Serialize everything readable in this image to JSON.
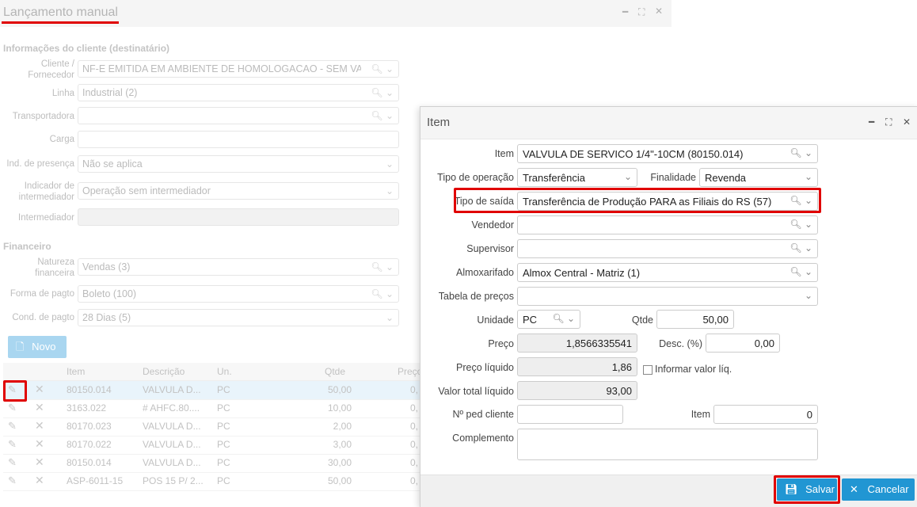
{
  "bg": {
    "title": "Lançamento manual",
    "section_client": "Informações do cliente (destinatário)",
    "section_fin": "Financeiro",
    "fields": {
      "cliente_label": "Cliente / Fornecedor",
      "cliente_value": "NF-E EMITIDA EM AMBIENTE DE HOMOLOGACAO - SEM VALOR",
      "linha_label": "Linha",
      "linha_value": "Industrial (2)",
      "transp_label": "Transportadora",
      "carga_label": "Carga",
      "presenca_label": "Ind. de presença",
      "presenca_value": "Não se aplica",
      "indicador_label": "Indicador de intermediador",
      "indicador_value": "Operação sem intermediador",
      "intermediador_label": "Intermediador",
      "natureza_label": "Natureza financeira",
      "natureza_value": "Vendas (3)",
      "forma_label": "Forma de pagto",
      "forma_value": "Boleto (100)",
      "cond_label": "Cond. de pagto",
      "cond_value": "28 Dias (5)"
    },
    "novo_label": "Novo",
    "grid": {
      "headers": [
        "Item",
        "Descrição",
        "Un.",
        "Qtde",
        "Preço"
      ],
      "rows": [
        {
          "item": "80150.014",
          "desc": "VALVULA D...",
          "un": "PC",
          "qtde": "50,00",
          "preco": "0,"
        },
        {
          "item": "3163.022",
          "desc": "# AHFC.80....",
          "un": "PC",
          "qtde": "10,00",
          "preco": "0,"
        },
        {
          "item": "80170.023",
          "desc": "VALVULA D...",
          "un": "PC",
          "qtde": "2,00",
          "preco": "0,"
        },
        {
          "item": "80170.022",
          "desc": "VALVULA D...",
          "un": "PC",
          "qtde": "3,00",
          "preco": "0,"
        },
        {
          "item": "80150.014",
          "desc": "VALVULA D...",
          "un": "PC",
          "qtde": "30,00",
          "preco": "0,"
        },
        {
          "item": "ASP-6011-15",
          "desc": "POS 15 P/ 2...",
          "un": "PC",
          "qtde": "50,00",
          "preco": "0,"
        }
      ]
    }
  },
  "dialog": {
    "title": "Item",
    "item_label": "Item",
    "item_value": "VALVULA DE SERVICO 1/4\"-10CM (80150.014)",
    "tipo_op_label": "Tipo de operação",
    "tipo_op_value": "Transferência",
    "finalidade_label": "Finalidade",
    "finalidade_value": "Revenda",
    "tipo_saida_label": "Tipo de saída",
    "tipo_saida_value": "Transferência de Produção PARA as Filiais do RS (57)",
    "vendedor_label": "Vendedor",
    "supervisor_label": "Supervisor",
    "almox_label": "Almoxarifado",
    "almox_value": "Almox Central - Matriz (1)",
    "tabela_label": "Tabela de preços",
    "unidade_label": "Unidade",
    "unidade_value": "PC",
    "qtde_label": "Qtde",
    "qtde_value": "50,00",
    "preco_label": "Preço",
    "preco_value": "1,8566335541",
    "desc_label": "Desc. (%)",
    "desc_value": "0,00",
    "preco_liq_label": "Preço líquido",
    "preco_liq_value": "1,86",
    "informar_label": "Informar valor líq.",
    "valor_total_label": "Valor total líquido",
    "valor_total_value": "93,00",
    "ped_cliente_label": "Nº ped cliente",
    "item2_label": "Item",
    "item2_value": "0",
    "complemento_label": "Complemento",
    "salvar_label": "Salvar",
    "cancelar_label": "Cancelar"
  },
  "colors": {
    "highlight": "#e00000",
    "primary_button": "#2196d3",
    "novo_button": "#a9d6f0"
  }
}
